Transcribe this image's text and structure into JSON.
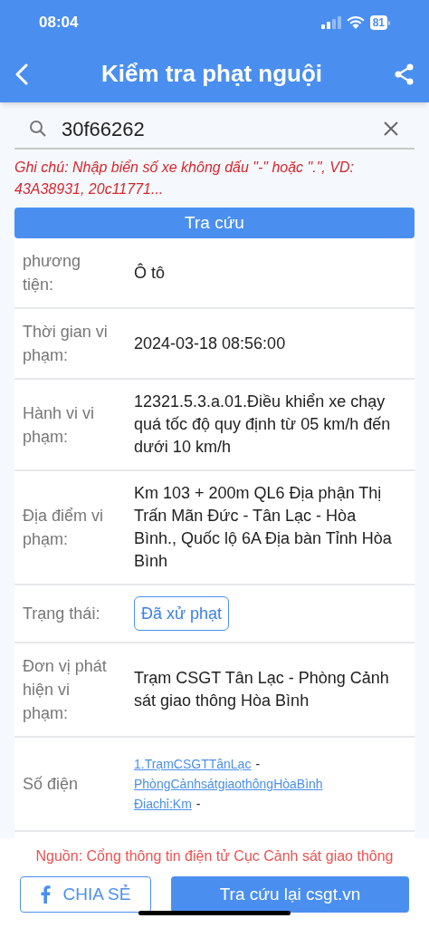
{
  "status_bar": {
    "time": "08:04",
    "battery": "81"
  },
  "header": {
    "title": "Kiểm tra phạt nguội"
  },
  "search": {
    "value": "30f66262"
  },
  "note": "Ghi chú: Nhập biển số xe không dấu \"-\" hoặc \".\", VD: 43A38931, 20c11771...",
  "search_button": "Tra cứu",
  "rows": [
    {
      "kind": "text",
      "label": "phương\ntiện:",
      "value": "Ô tô"
    },
    {
      "kind": "text",
      "label": "Thời gian vi phạm:",
      "value": "2024-03-18 08:56:00"
    },
    {
      "kind": "text",
      "label": "Hành vi vi phạm:",
      "value": "12321.5.3.a.01.Điều khiển xe chạy quá tốc độ quy định từ 05 km/h đến dưới 10 km/h"
    },
    {
      "kind": "text",
      "label": "Địa điểm vi phạm:",
      "value": "Km 103 + 200m QL6 Địa phận Thị Trấn Mãn Đức - Tân Lạc - Hòa Bình., Quốc lộ 6A Địa bàn Tỉnh Hòa Bình"
    },
    {
      "kind": "badge",
      "label": "Trạng thái:",
      "value": "Đã xử phạt"
    },
    {
      "kind": "text",
      "label": "Đơn vị phát hiện vi phạm:",
      "value": "Trạm CSGT Tân Lạc - Phòng Cảnh sát giao thông Hòa Bình"
    },
    {
      "kind": "links",
      "label": "Số điện",
      "lines": [
        [
          {
            "kind": "link",
            "text": "1.TrạmCSGTTânLạc"
          },
          {
            "kind": "text",
            "text": "-"
          }
        ],
        [
          {
            "kind": "link",
            "text": "PhòngCảnhsátgiaothôngHòaBình"
          }
        ],
        [
          {
            "kind": "link",
            "text": "Điachỉ:Km"
          },
          {
            "kind": "text",
            "text": "-"
          }
        ]
      ]
    }
  ],
  "source": "Nguồn: Cổng thông tin điện tử Cục Cảnh sát giao thông",
  "share_button": "CHIA SẺ",
  "recheck_button": "Tra cứu lại csgt.vn"
}
